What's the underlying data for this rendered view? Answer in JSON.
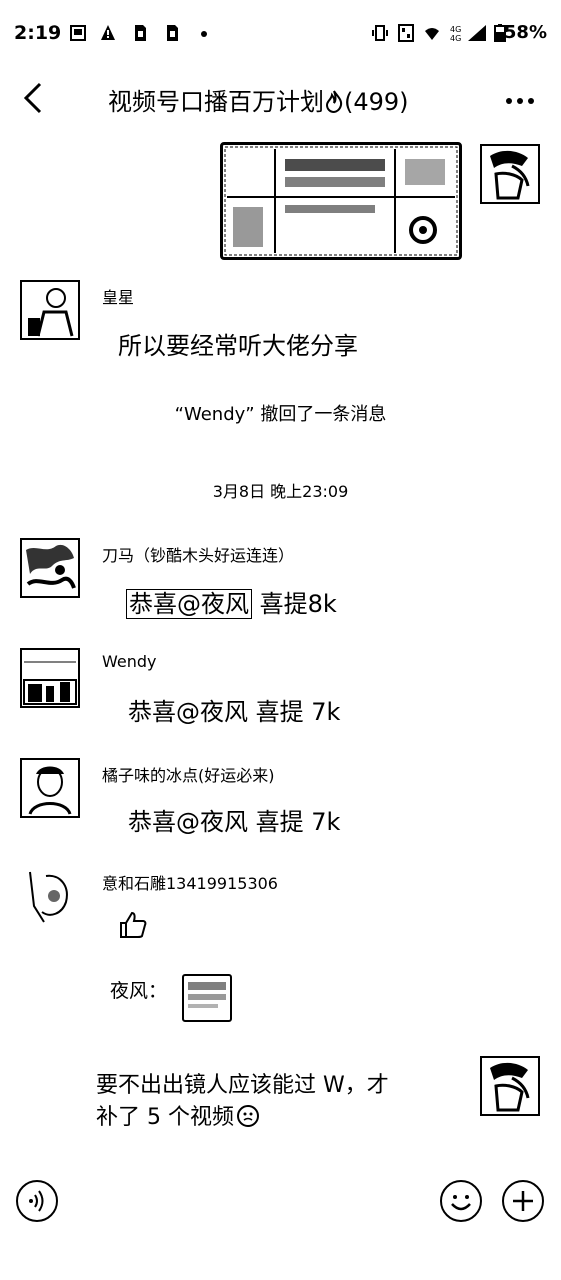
{
  "status_bar": {
    "time": "2:19",
    "battery": "58%"
  },
  "header": {
    "title": "视频号口播百万计划",
    "member_count": "(499)",
    "back_icon": "chevron-left-icon",
    "more_icon": "more-dots-icon"
  },
  "messages": {
    "m1": {
      "sender": "皇星",
      "text": "所以要经常听大佬分享"
    },
    "recall": "“Wendy” 撤回了一条消息",
    "timestamp": "3月8日 晚上23:09",
    "m2": {
      "sender": "刀马（钞酷木头好运连连）",
      "mention": "恭喜@夜风",
      "text": "喜提8k"
    },
    "m3": {
      "sender": "Wendy",
      "text": "恭喜@夜风  喜提 7k"
    },
    "m4": {
      "sender": "橘子味的冰点(好运必来)",
      "text": "恭喜@夜风  喜提 7k"
    },
    "m5": {
      "sender": "意和石雕13419915306",
      "emoji": "thumbs-up-icon",
      "quote_label": "夜风："
    },
    "m6": {
      "line1": "要不出出镜人应该能过 W，才",
      "line2": "补了 5 个视频"
    }
  },
  "input_bar": {
    "voice_icon": "voice-icon",
    "emoji_icon": "smile-icon",
    "plus_icon": "plus-icon"
  }
}
